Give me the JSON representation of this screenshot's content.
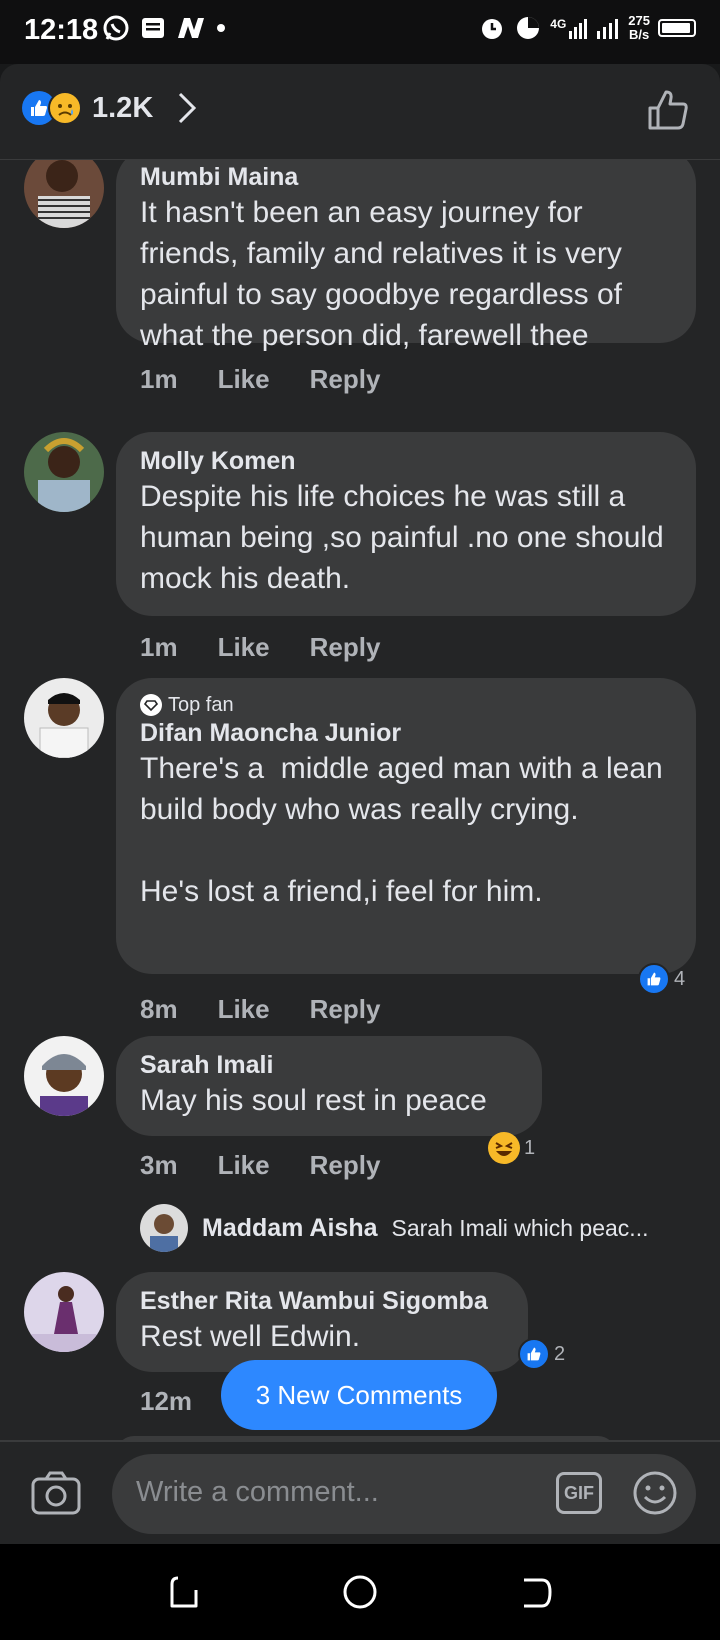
{
  "status_bar": {
    "time": "12:18",
    "net_top": "4G",
    "net_speed_value": "275",
    "net_speed_unit": "B/s"
  },
  "header": {
    "reaction_count": "1.2K"
  },
  "comments": [
    {
      "name": "Mumbi Maina",
      "text": "It hasn't been an easy journey for friends, family and relatives it is very painful to say goodbye regardless of what the person did, farewell thee",
      "time": "1m",
      "like": "Like",
      "reply": "Reply"
    },
    {
      "name": "Molly Komen",
      "text": "Despite his life choices he was still a human being ,so painful .no one should mock his death.",
      "time": "1m",
      "like": "Like",
      "reply": "Reply"
    },
    {
      "badge": "Top fan",
      "name": "Difan Maoncha Junior",
      "text": "There's a  middle aged man with a lean build body who was really crying.\n\nHe's lost a friend,i feel for him.",
      "time": "8m",
      "like": "Like",
      "reply": "Reply",
      "reaction_count": "4"
    },
    {
      "name": "Sarah Imali",
      "text": "May his soul rest in peace",
      "time": "3m",
      "like": "Like",
      "reply": "Reply",
      "reaction_count": "1",
      "reply_preview": {
        "name": "Maddam Aisha",
        "text": "Sarah Imali which peac..."
      }
    },
    {
      "name": "Esther Rita Wambui Sigomba",
      "text": "Rest well Edwin.",
      "time": "12m",
      "reaction_count": "2"
    }
  ],
  "new_comments_button": "3 New Comments",
  "composer": {
    "placeholder": "Write a comment...",
    "gif_label": "GIF"
  },
  "colors": {
    "background": "#242526",
    "bubble": "#3a3b3c",
    "accent": "#2d88ff"
  }
}
